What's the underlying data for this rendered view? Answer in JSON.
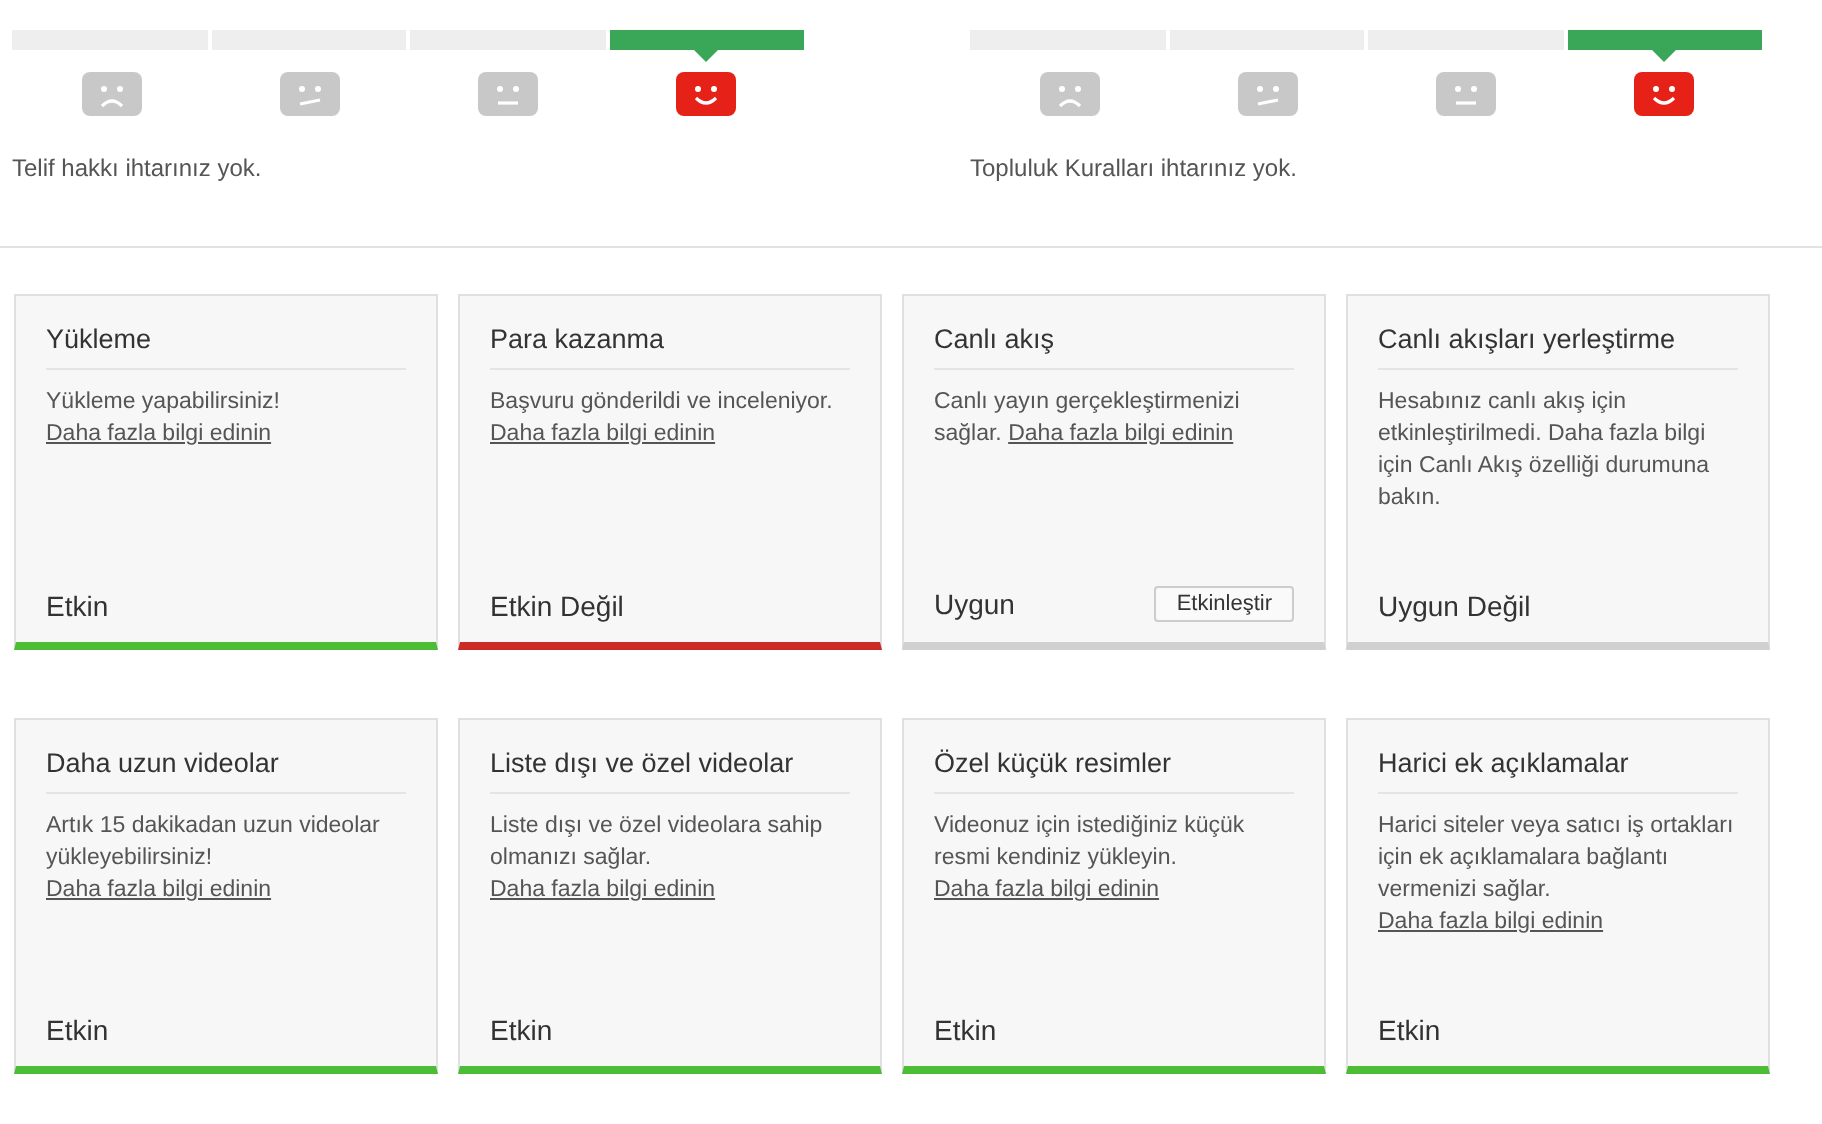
{
  "strike_panels": [
    {
      "segments": [
        {
          "kind": "sad",
          "selected": false
        },
        {
          "kind": "unsure",
          "selected": false
        },
        {
          "kind": "neutral",
          "selected": false
        },
        {
          "kind": "happy",
          "selected": true
        }
      ],
      "message": "Telif hakkı ihtarınız yok."
    },
    {
      "segments": [
        {
          "kind": "sad",
          "selected": false
        },
        {
          "kind": "unsure",
          "selected": false
        },
        {
          "kind": "neutral",
          "selected": false
        },
        {
          "kind": "happy",
          "selected": true
        }
      ],
      "message": "Topluluk Kuralları ihtarınız yok."
    }
  ],
  "features": [
    {
      "title": "Yükleme",
      "text": "Yükleme yapabilirsiniz!",
      "link": "Daha fazla bilgi edinin",
      "status": "Etkin",
      "kind": "enabled"
    },
    {
      "title": "Para kazanma",
      "text": "Başvuru gönderildi ve inceleniyor.",
      "link": "Daha fazla bilgi edinin",
      "status": "Etkin Değil",
      "kind": "disabled"
    },
    {
      "title": "Canlı akış",
      "text": "Canlı yayın gerçekleştirmenizi sağlar.",
      "link": "Daha fazla bilgi edinin",
      "status": "Uygun",
      "kind": "eligible",
      "button": "Etkinleştir"
    },
    {
      "title": "Canlı akışları yerleştirme",
      "text": "Hesabınız canlı akış için etkinleştirilmedi. Daha fazla bilgi için Canlı Akış özelliği durumuna bakın.",
      "status": "Uygun Değil",
      "kind": "ineligible"
    },
    {
      "title": "Daha uzun videolar",
      "text": "Artık 15 dakikadan uzun videolar yükleyebilirsiniz!",
      "link": "Daha fazla bilgi edinin",
      "status": "Etkin",
      "kind": "enabled"
    },
    {
      "title": "Liste dışı ve özel videolar",
      "text": "Liste dışı ve özel videolara sahip olmanızı sağlar.",
      "link": "Daha fazla bilgi edinin",
      "status": "Etkin",
      "kind": "enabled"
    },
    {
      "title": "Özel küçük resimler",
      "text": "Videonuz için istediğiniz küçük resmi kendiniz yükleyin.",
      "link": "Daha fazla bilgi edinin",
      "status": "Etkin",
      "kind": "enabled"
    },
    {
      "title": "Harici ek açıklamalar",
      "text": "Harici siteler veya satıcı iş ortakları için ek açıklamalara bağlantı vermenizi sağlar.",
      "link": "Daha fazla bilgi edinin",
      "status": "Etkin",
      "kind": "enabled"
    }
  ]
}
